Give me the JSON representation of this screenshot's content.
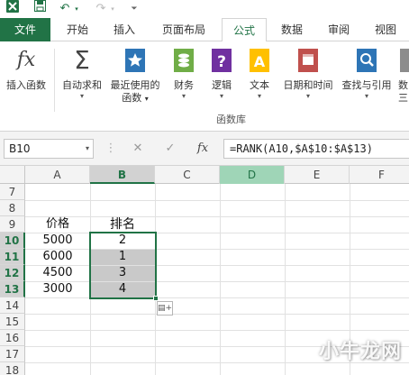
{
  "ribbon_tabs": [
    "文件",
    "开始",
    "插入",
    "页面布局",
    "公式",
    "数据",
    "审阅",
    "视图"
  ],
  "active_tab": "公式",
  "ribbon_buttons": [
    {
      "label": "插入函数",
      "icon": "fx-icon"
    },
    {
      "label": "自动求和",
      "icon": "sigma-icon"
    },
    {
      "label": "最近使用的",
      "label2": "函数",
      "icon": "star-book-icon"
    },
    {
      "label": "财务",
      "icon": "coins-book-icon"
    },
    {
      "label": "逻辑",
      "icon": "question-book-icon"
    },
    {
      "label": "文本",
      "icon": "text-book-icon"
    },
    {
      "label": "日期和时间",
      "icon": "clock-book-icon"
    },
    {
      "label": "查找与引用",
      "icon": "magnifier-book-icon"
    },
    {
      "label": "数",
      "label2": "三",
      "icon": "more-icon"
    }
  ],
  "group_label": "函数库",
  "name_box": "B10",
  "formula": "=RANK(A10,$A$10:$A$13)",
  "columns": [
    "A",
    "B",
    "C",
    "D",
    "E",
    "F"
  ],
  "rows": [
    "7",
    "8",
    "9",
    "10",
    "11",
    "12",
    "13",
    "14",
    "15",
    "16",
    "17",
    "18"
  ],
  "cells": {
    "A9": "价格",
    "B9": "排名",
    "A10": "5000",
    "B10": "2",
    "A11": "6000",
    "B11": "1",
    "A12": "4500",
    "B12": "3",
    "A13": "3000",
    "B13": "4"
  },
  "watermark": "小牛龙网",
  "colors": {
    "accent": "#217346",
    "selection": "#c9c9c9",
    "highlight_col": "#9fd5b7"
  }
}
